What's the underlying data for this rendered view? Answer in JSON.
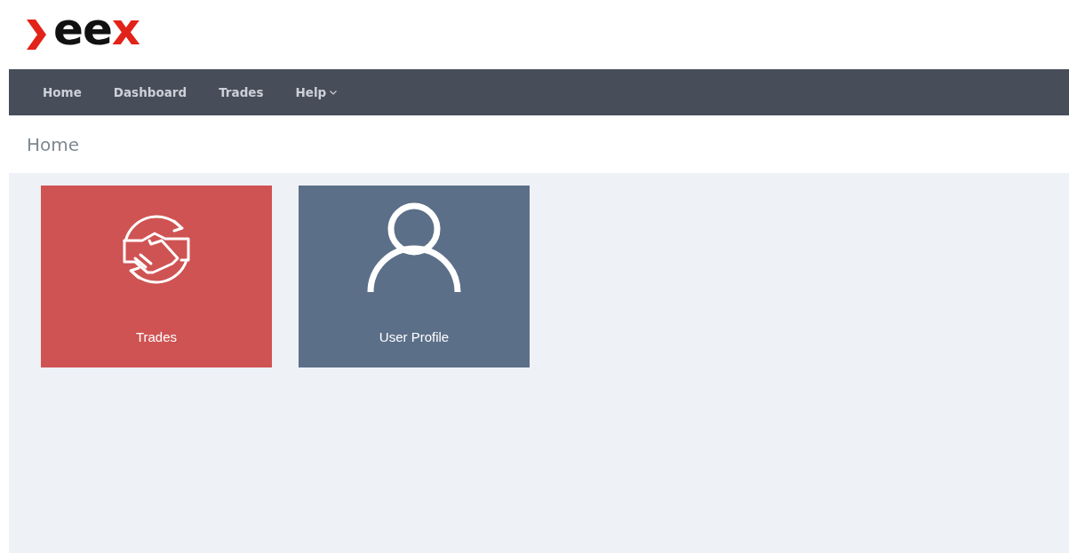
{
  "logo": {
    "parts": [
      {
        "text": "ee",
        "color": "#111111"
      },
      {
        "text": "x",
        "color": "#e2231a"
      }
    ]
  },
  "nav": {
    "items": [
      {
        "label": "Home",
        "dropdown": false
      },
      {
        "label": "Dashboard",
        "dropdown": false
      },
      {
        "label": "Trades",
        "dropdown": false
      },
      {
        "label": "Help",
        "dropdown": true
      }
    ]
  },
  "page_title": "Home",
  "tiles": [
    {
      "label": "Trades",
      "kind": "handshake",
      "color": "#cf5353"
    },
    {
      "label": "User Profile",
      "kind": "user",
      "color": "#5c6f89"
    }
  ]
}
